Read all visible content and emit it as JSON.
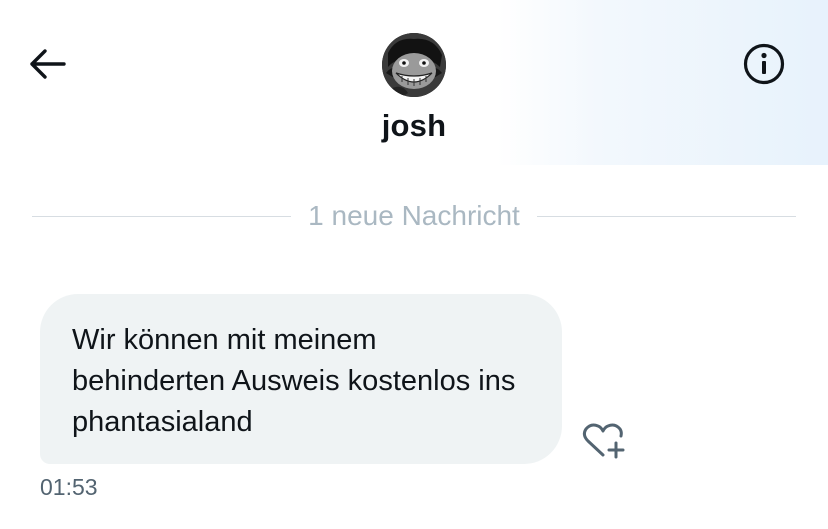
{
  "header": {
    "username": "josh",
    "back_icon": "arrow-left-icon",
    "info_icon": "info-icon",
    "avatar_icon": "avatar-image"
  },
  "divider": {
    "label": "1 neue Nachricht"
  },
  "messages": [
    {
      "text": "Wir können mit meinem behinderten Ausweis kostenlos ins phantasialand",
      "time": "01:53",
      "react_icon": "heart-plus-icon"
    }
  ],
  "colors": {
    "text": "#0f1419",
    "muted": "#536471",
    "divider_text": "#aab8c2",
    "bubble_bg": "#eff3f4"
  }
}
